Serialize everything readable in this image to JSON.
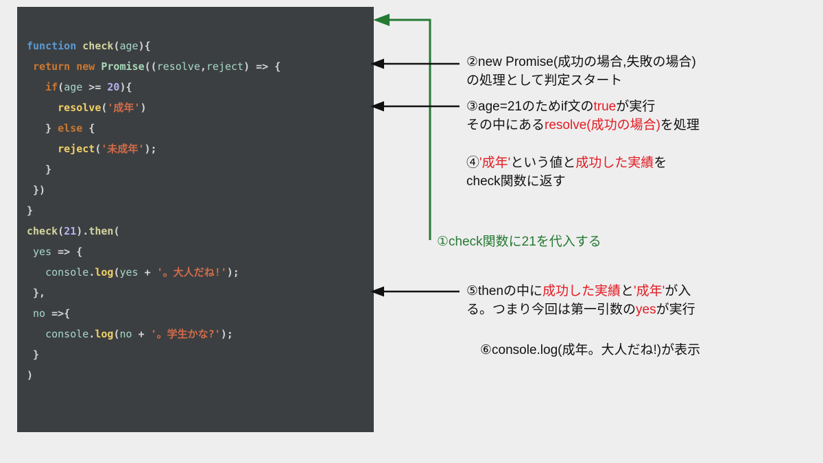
{
  "code": {
    "l1": {
      "kw": "function",
      "fn": "check",
      "p1": "(",
      "arg": "age",
      "p2": ")",
      "br": "{"
    },
    "l2": {
      "kw": "return",
      "kw2": "new",
      "type": "Promise",
      "p1": "((",
      "a1": "resolve",
      "c": ",",
      "a2": "reject",
      "p2": ")",
      "arrow": " => ",
      "br": "{"
    },
    "l3": {
      "kw": "if",
      "p1": "(",
      "v": "age",
      "op": " >= ",
      "num": "20",
      "p2": ")",
      "br": "{"
    },
    "l4": {
      "fn": "resolve",
      "p1": "(",
      "str": "'成年'",
      "p2": ")"
    },
    "l5": {
      "br": "}",
      "kw": "else",
      "br2": "{"
    },
    "l6": {
      "fn": "reject",
      "p1": "(",
      "str": "'未成年'",
      "p2": ");"
    },
    "l7": {
      "br": "}"
    },
    "l8": {
      "br": "})"
    },
    "l9": {
      "br": "}"
    },
    "l10": {
      "fn": "check",
      "p1": "(",
      "num": "21",
      "p2": ").",
      "m": "then",
      "p3": "("
    },
    "l11": {
      "v": "yes",
      "arrow": " => ",
      "br": "{"
    },
    "l12": {
      "obj": "console",
      "dot": ".",
      "m": "log",
      "p1": "(",
      "v": "yes",
      "plus": " + ",
      "str": "'。大人だね!'",
      "p2": ");"
    },
    "l13": {
      "br": "},"
    },
    "l14": {
      "v": "no",
      "arrow": " =>",
      "br": "{"
    },
    "l15": {
      "obj": "console",
      "dot": ".",
      "m": "log",
      "p1": "(",
      "v": "no",
      "plus": " + ",
      "str": "'。学生かな?'",
      "p2": ");"
    },
    "l16": {
      "br": "}"
    },
    "l17": {
      "br": ")"
    }
  },
  "notes": {
    "n2a": "②new Promise(成功の場合,失敗の場合)",
    "n2b": "の処理として判定スタート",
    "n3a_1": "③age=21のためif文の",
    "n3a_red": "true",
    "n3a_2": "が実行",
    "n3b_1": "その中にある",
    "n3b_red": "resolve(成功の場合)",
    "n3b_2": "を処理",
    "n4a_1": "④",
    "n4a_red1": "'成年'",
    "n4a_2": "という値と",
    "n4a_red2": "成功した実績",
    "n4a_3": "を",
    "n4b": "check関数に返す",
    "n1": "①check関数に21を代入する",
    "n5a_1": "⑤thenの中に",
    "n5a_red1": "成功した実績",
    "n5a_2": "と",
    "n5a_red2": "'成年'",
    "n5a_3": "が入",
    "n5b_1": "る。つまり今回は第一引数の",
    "n5b_red": "yes",
    "n5b_2": "が実行",
    "n6": "⑥console.log(成年。大人だね!)が表示"
  }
}
